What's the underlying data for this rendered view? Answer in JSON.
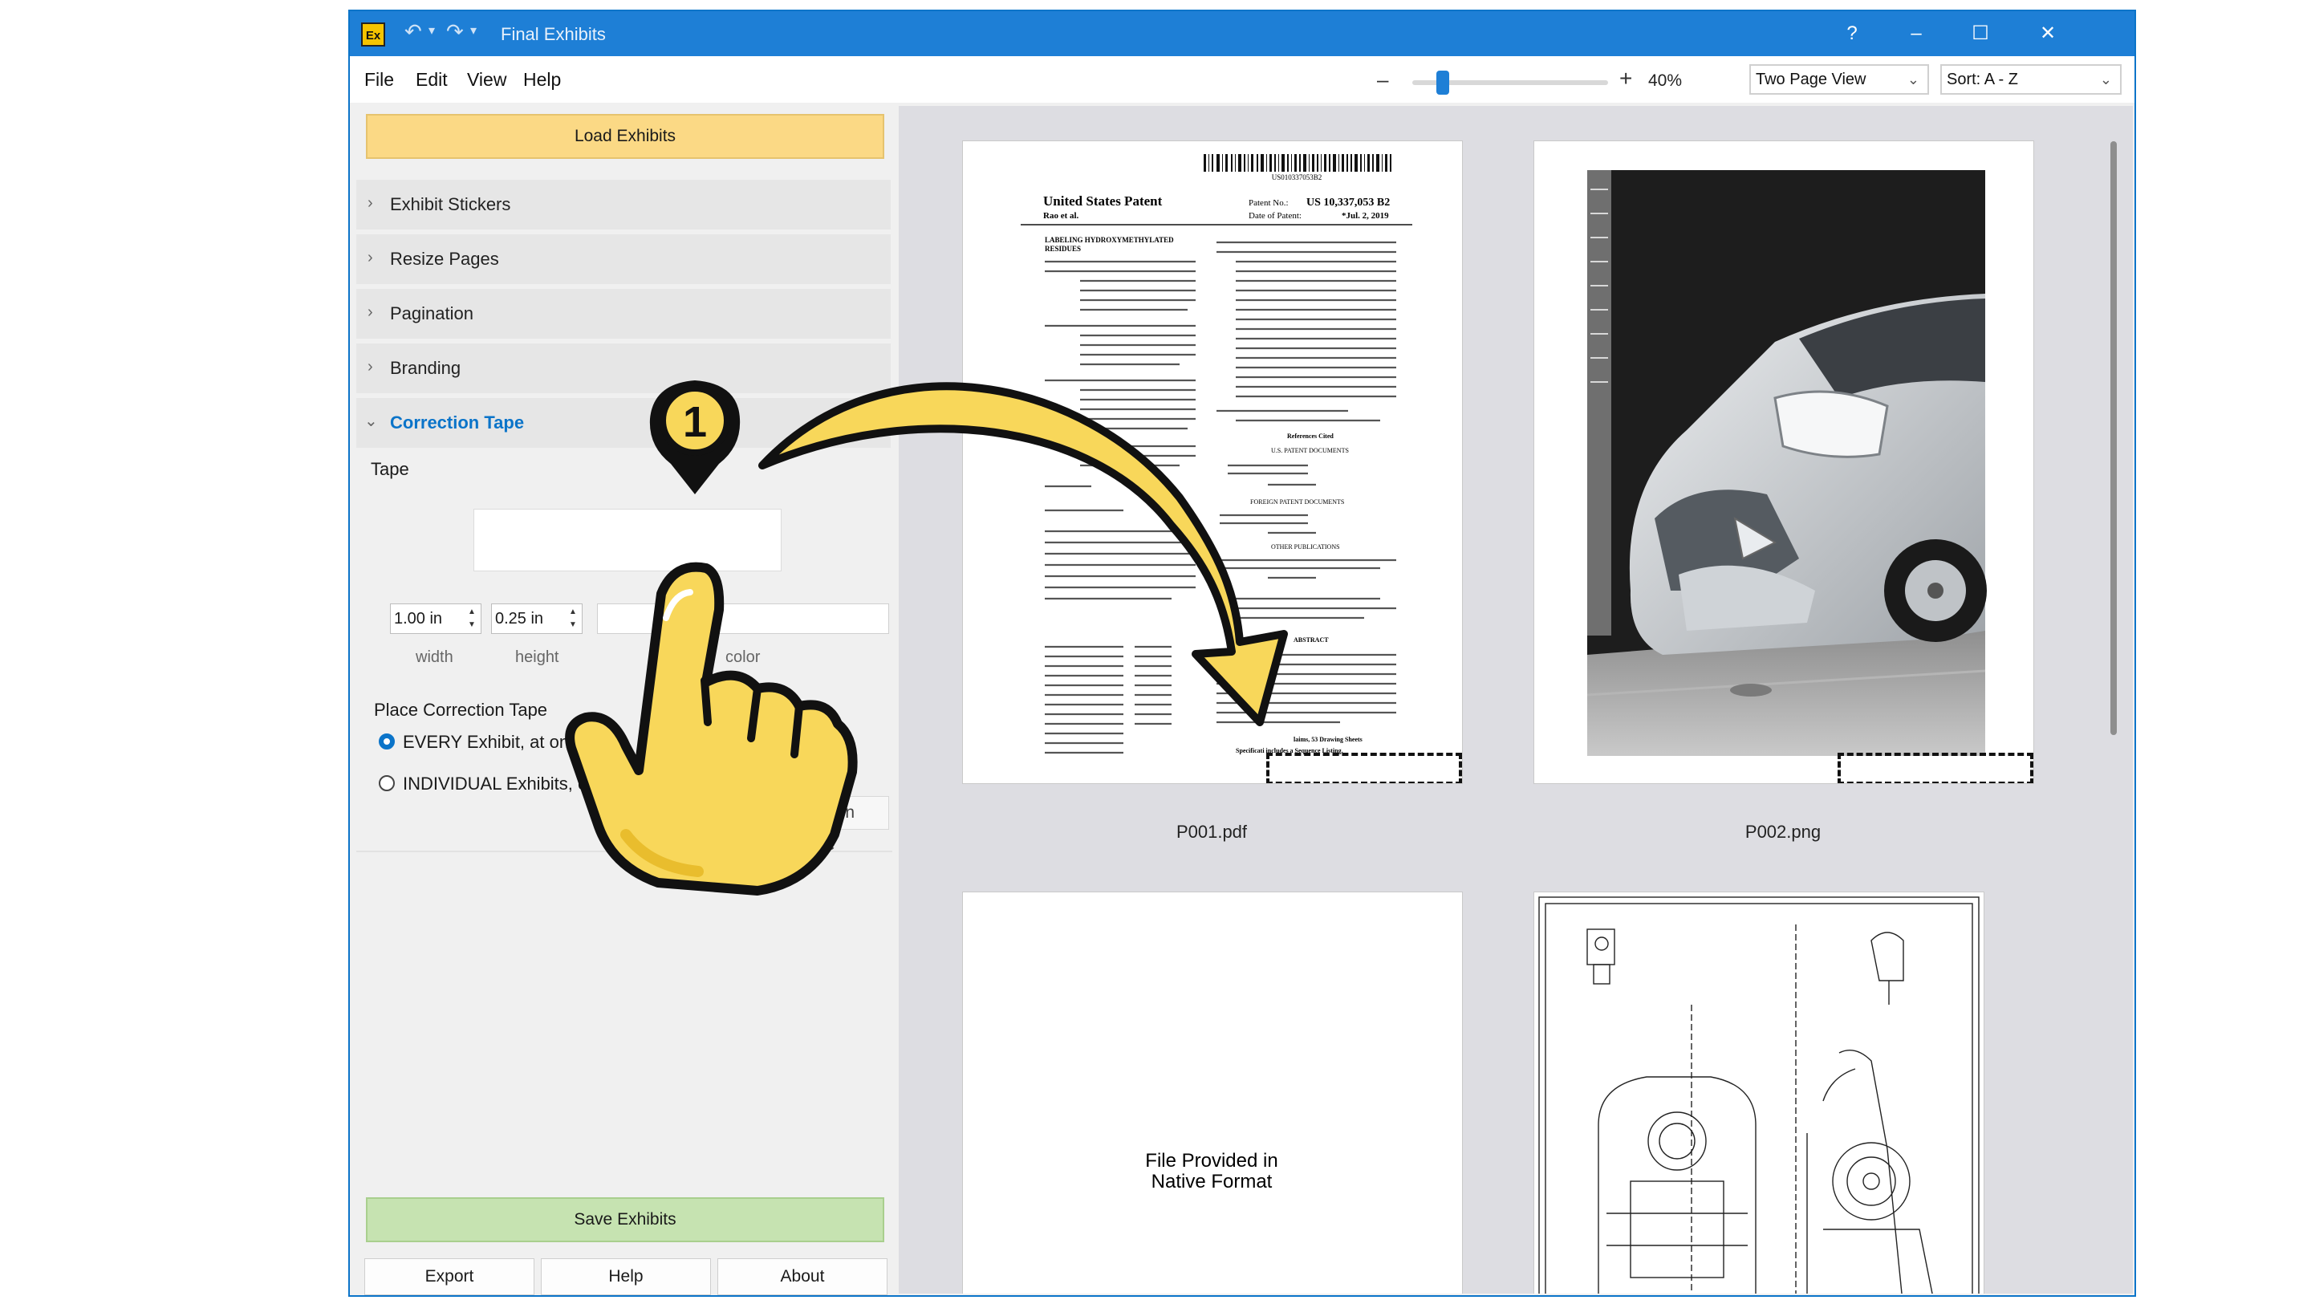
{
  "window": {
    "app_icon_text": "Ex",
    "title": "Final Exhibits",
    "help_glyph": "?",
    "minimize_glyph": "–",
    "maximize_glyph": "☐",
    "close_glyph": "✕"
  },
  "menu": {
    "file": "File",
    "edit": "Edit",
    "view": "View",
    "help": "Help"
  },
  "toolbar": {
    "zoom_minus": "–",
    "zoom_plus": "+",
    "zoom_value": "40%",
    "zoom_level_percent": 40,
    "view_mode": "Two Page View",
    "sort": "Sort: A - Z"
  },
  "sidebar": {
    "load_button": "Load Exhibits",
    "sections": [
      {
        "label": "Exhibit Stickers",
        "open": false
      },
      {
        "label": "Resize Pages",
        "open": false
      },
      {
        "label": "Pagination",
        "open": false
      },
      {
        "label": "Branding",
        "open": false
      },
      {
        "label": "Correction Tape",
        "open": true
      }
    ],
    "correction_tape": {
      "tape_label": "Tape",
      "width_value": "1.00 in",
      "height_value": "0.25 in",
      "width_label": "width",
      "height_label": "height",
      "color_label": "color",
      "place_label": "Place Correction Tape",
      "option_every": "EVERY Exhibit, at on",
      "option_individual": "INDIVIDUAL Exhibits, o",
      "apply_button": "rrection Tape"
    },
    "save_button": "Save Exhibits",
    "footer": {
      "export": "Export",
      "help": "Help",
      "about": "About"
    }
  },
  "viewer": {
    "pages": [
      {
        "filename": "P001.pdf"
      },
      {
        "filename": "P002.png"
      }
    ],
    "native_text_line1": "File Provided in",
    "native_text_line2": "Native Format"
  },
  "patent": {
    "barcode_number": "US010337053B2",
    "header_left": "United States Patent",
    "inventor_short": "Rao et al.",
    "patent_no_label": "Patent No.:",
    "patent_no": "US 10,337,053 B2",
    "date_label": "Date of Patent:",
    "date": "*Jul. 2, 2019",
    "title_line1": "LABELING HYDROXYMETHYLATED",
    "title_line2": "RESIDUES",
    "abstract_heading": "ABSTRACT",
    "refs_heading": "References Cited",
    "us_docs": "U.S. PATENT DOCUMENTS",
    "foreign_docs": "FOREIGN PATENT DOCUMENTS",
    "other_pubs": "OTHER PUBLICATIONS",
    "claims_line": "laims, 53 Drawing Sheets",
    "spec_line": "Specificati    includes a Sequence Listing."
  },
  "annotation": {
    "step_number": "1",
    "accent_color": "#f8d75a"
  }
}
